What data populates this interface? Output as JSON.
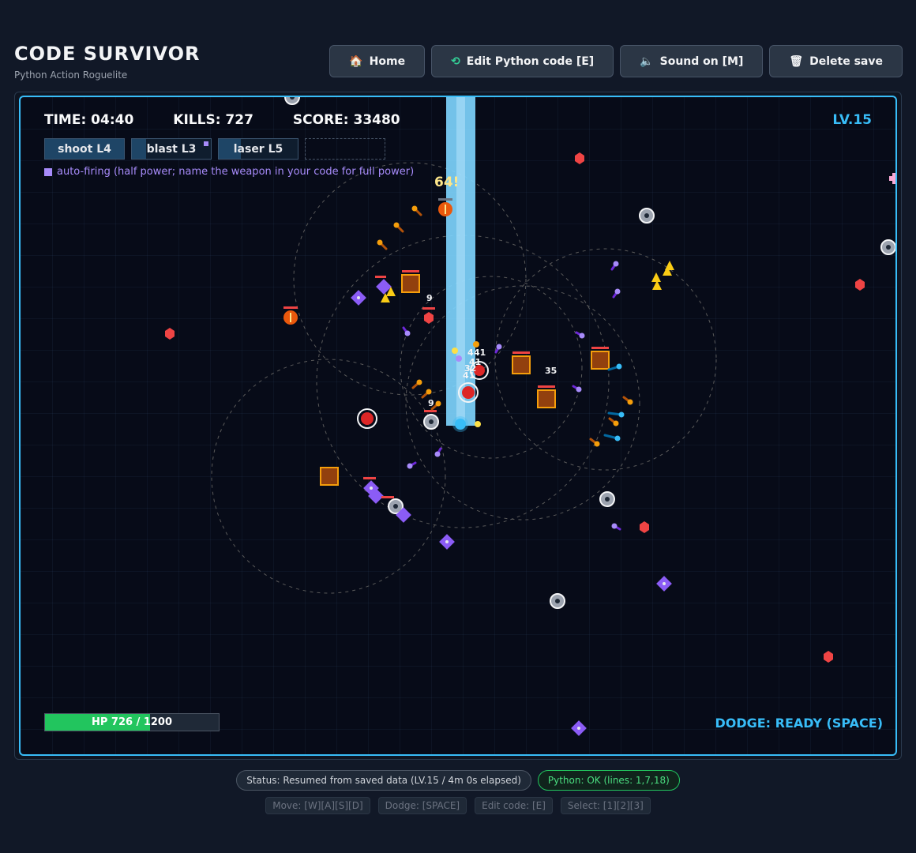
{
  "header": {
    "title": "CODE SURVIVOR",
    "subtitle": "Python Action Roguelite"
  },
  "toolbar": {
    "home": {
      "icon": "🏠",
      "label": "Home"
    },
    "edit": {
      "icon": "⟲",
      "label": "Edit Python code [E]"
    },
    "sound": {
      "icon": "🔈",
      "label": "Sound on [M]"
    },
    "delete": {
      "icon": "🗑",
      "label": "Delete save"
    }
  },
  "hud": {
    "time": "TIME: 04:40",
    "kills": "KILLS: 727",
    "score": "SCORE: 33480",
    "level": "LV.15",
    "weapons": [
      {
        "label": "shoot L4",
        "charge": 1.0,
        "auto": false
      },
      {
        "label": "blast L3",
        "charge": 0.18,
        "auto": true
      },
      {
        "label": "laser L5",
        "charge": 0.28,
        "auto": false
      },
      {
        "label": "",
        "charge": 0,
        "auto": false
      }
    ],
    "autofire_note": "auto-firing (half power; name the weapon in your code for full power)",
    "hp_label": "HP 726 / 1200",
    "hp_fraction": 0.605,
    "dodge": "DODGE: READY (SPACE)"
  },
  "damage_numbers": [
    "64!",
    "9",
    "9",
    "35",
    "4",
    "41",
    "41",
    "32",
    "41"
  ],
  "colors": {
    "accent": "#38bdf8",
    "hp": "#22c55e",
    "auto": "#a78bfa",
    "ok": "#4ade80"
  },
  "status": {
    "message": "Status: Resumed from saved data (LV.15 / 4m 0s elapsed)",
    "python": "Python: OK (lines: 1,7,18)"
  },
  "keys": {
    "move": "Move: [W][A][S][D]",
    "dodge": "Dodge: [SPACE]",
    "edit": "Edit code: [E]",
    "select": "Select: [1][2][3]"
  }
}
